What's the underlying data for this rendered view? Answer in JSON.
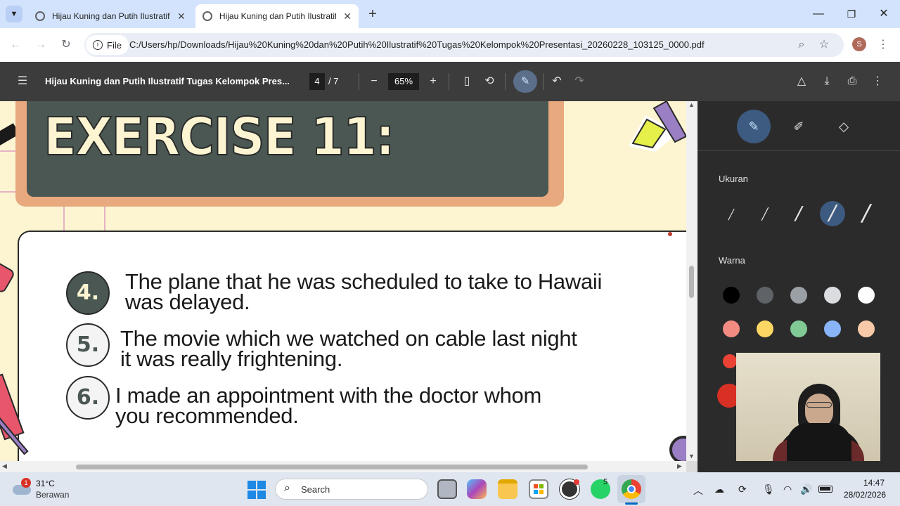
{
  "browser": {
    "tabs": [
      {
        "title": "Hijau Kuning dan Putih Ilustratif",
        "active": false
      },
      {
        "title": "Hijau Kuning dan Putih Ilustratif",
        "active": true
      }
    ],
    "new_tab": "+",
    "omnibox_chip": "File",
    "url": "C:/Users/hp/Downloads/Hijau%20Kuning%20dan%20Putih%20Ilustratif%20Tugas%20Kelompok%20Presentasi_20260228_103125_0000.pdf",
    "profile_initial": "S"
  },
  "pdf_toolbar": {
    "title": "Hijau Kuning dan Putih Ilustratif Tugas Kelompok Pres...",
    "page_current": "4",
    "page_total": "/  7",
    "zoom": "65%"
  },
  "slide": {
    "title": "EXERCISE 11:",
    "items": [
      {
        "number": "4.",
        "line1": "The plane that he was scheduled to take to Hawaii",
        "line2": "was delayed."
      },
      {
        "number": "5.",
        "line1": "The movie which we watched on cable last night",
        "line2": "it was really frightening."
      },
      {
        "number": "6.",
        "line1": "I made an appointment with the doctor whom",
        "line2": "you recommended."
      }
    ]
  },
  "annotation_panel": {
    "size_label": "Ukuran",
    "color_label": "Warna",
    "colors_row1": [
      "#000000",
      "#5f6368",
      "#9aa0a6",
      "#dadce0",
      "#ffffff"
    ],
    "colors_row2": [
      "#f28b82",
      "#fdd663",
      "#81c995",
      "#8ab4f8",
      "#f8c9a8"
    ]
  },
  "taskbar": {
    "weather_temp": "31°C",
    "weather_desc": "Berawan",
    "weather_badge": "1",
    "search_placeholder": "Search",
    "whatsapp_badge": "5",
    "time": "14:47",
    "date": "28/02/2026"
  }
}
